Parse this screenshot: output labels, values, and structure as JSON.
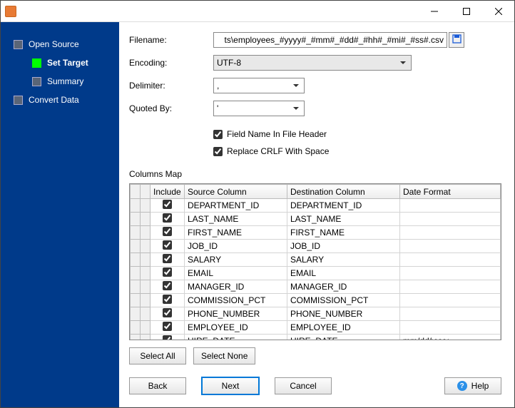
{
  "window": {
    "title": ""
  },
  "sidebar": {
    "items": [
      {
        "label": "Open Source",
        "active": false,
        "child": false
      },
      {
        "label": "Set Target",
        "active": true,
        "child": true,
        "current": true
      },
      {
        "label": "Summary",
        "active": false,
        "child": true
      },
      {
        "label": "Convert Data",
        "active": false,
        "child": false
      }
    ]
  },
  "form": {
    "filename_label": "Filename:",
    "filename_value": "ts\\employees_#yyyy#_#mm#_#dd#_#hh#_#mi#_#ss#.csv",
    "encoding_label": "Encoding:",
    "encoding_value": "UTF-8",
    "delimiter_label": "Delimiter:",
    "delimiter_value": ",",
    "quoted_label": "Quoted By:",
    "quoted_value": "'",
    "cb_fieldname_label": "Field Name In File Header",
    "cb_fieldname_checked": true,
    "cb_crlf_label": "Replace CRLF With Space",
    "cb_crlf_checked": true,
    "columns_map_label": "Columns Map"
  },
  "table": {
    "headers": {
      "include": "Include",
      "source": "Source Column",
      "dest": "Destination Column",
      "dateformat": "Date Format"
    },
    "rows": [
      {
        "include": true,
        "source": "DEPARTMENT_ID",
        "dest": "DEPARTMENT_ID",
        "dateformat": ""
      },
      {
        "include": true,
        "source": "LAST_NAME",
        "dest": "LAST_NAME",
        "dateformat": ""
      },
      {
        "include": true,
        "source": "FIRST_NAME",
        "dest": "FIRST_NAME",
        "dateformat": ""
      },
      {
        "include": true,
        "source": "JOB_ID",
        "dest": "JOB_ID",
        "dateformat": ""
      },
      {
        "include": true,
        "source": "SALARY",
        "dest": "SALARY",
        "dateformat": ""
      },
      {
        "include": true,
        "source": "EMAIL",
        "dest": "EMAIL",
        "dateformat": ""
      },
      {
        "include": true,
        "source": "MANAGER_ID",
        "dest": "MANAGER_ID",
        "dateformat": ""
      },
      {
        "include": true,
        "source": "COMMISSION_PCT",
        "dest": "COMMISSION_PCT",
        "dateformat": ""
      },
      {
        "include": true,
        "source": "PHONE_NUMBER",
        "dest": "PHONE_NUMBER",
        "dateformat": ""
      },
      {
        "include": true,
        "source": "EMPLOYEE_ID",
        "dest": "EMPLOYEE_ID",
        "dateformat": ""
      },
      {
        "include": true,
        "source": "HIRE_DATE",
        "dest": "HIRE_DATE",
        "dateformat": "mm/dd/yyyy"
      }
    ]
  },
  "buttons": {
    "select_all": "Select All",
    "select_none": "Select None",
    "back": "Back",
    "next": "Next",
    "cancel": "Cancel",
    "help": "Help"
  }
}
